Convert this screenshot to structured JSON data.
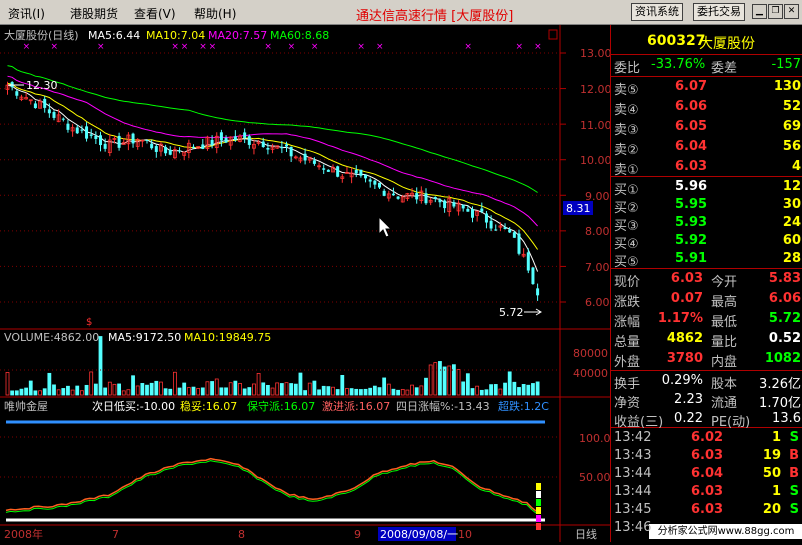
{
  "menu": {
    "items": [
      "资讯(I)",
      "港股期货",
      "查看(V)",
      "帮助(H)"
    ],
    "title": "通达信高速行情 [大厦股份]",
    "buttons": [
      "资讯系统",
      "委托交易"
    ]
  },
  "kline": {
    "header": {
      "name": "大厦股份(日线)",
      "ma5": "MA5:6.44",
      "ma10": "MA10:7.04",
      "ma20": "MA20:7.57",
      "ma60": "MA60:8.68"
    },
    "y_ticks": [
      "13.00",
      "12.00",
      "11.00",
      "10.00",
      "9.00",
      "8.00",
      "7.00",
      "6.00"
    ],
    "cursor_price": "8.31",
    "high_label": "12.30",
    "low_label": "5.72",
    "colors": {
      "ma5": "#ffffff",
      "ma10": "#ffff00",
      "ma20": "#ff00ff",
      "ma60": "#00ff00",
      "up": "#ff3232",
      "down": "#54ffff"
    }
  },
  "volume": {
    "header": {
      "vol": "VOLUME:4862.00",
      "ma5": "MA5:9172.50",
      "ma10": "MA10:19849.75"
    },
    "y_ticks": [
      "80000",
      "40000"
    ]
  },
  "indicator": {
    "header": {
      "name": "唯帅金屋",
      "a": "次日低买:-10.00",
      "b": "稳妥:16.07",
      "c": "保守派:16.07",
      "d": "激进派:16.07",
      "e": "四日涨幅%:-13.43",
      "f": "超跌:1.2C"
    },
    "y_ticks": [
      "100.0",
      "50.00"
    ]
  },
  "xaxis": {
    "labels": [
      "2008年",
      "7",
      "8",
      "9",
      "10"
    ],
    "cursor_date": "2008/09/08/一",
    "period": "日线"
  },
  "panel": {
    "code": "600327",
    "name": "大厦股份",
    "webi_label": "委比",
    "webi_value": "-33.76%",
    "wecha_label": "委差",
    "wecha_value": "-157",
    "sell": [
      {
        "label": "卖⑤",
        "price": "6.07",
        "vol": "130"
      },
      {
        "label": "卖④",
        "price": "6.06",
        "vol": "52"
      },
      {
        "label": "卖③",
        "price": "6.05",
        "vol": "69"
      },
      {
        "label": "卖②",
        "price": "6.04",
        "vol": "56"
      },
      {
        "label": "卖①",
        "price": "6.03",
        "vol": "4"
      }
    ],
    "buy": [
      {
        "label": "买①",
        "price": "5.96",
        "vol": "12"
      },
      {
        "label": "买②",
        "price": "5.95",
        "vol": "30"
      },
      {
        "label": "买③",
        "price": "5.93",
        "vol": "24"
      },
      {
        "label": "买④",
        "price": "5.92",
        "vol": "60"
      },
      {
        "label": "买⑤",
        "price": "5.91",
        "vol": "28"
      }
    ],
    "quote": [
      {
        "l1": "现价",
        "v1": "6.03",
        "l2": "今开",
        "v2": "5.83"
      },
      {
        "l1": "涨跌",
        "v1": "0.07",
        "l2": "最高",
        "v2": "6.06"
      },
      {
        "l1": "涨幅",
        "v1": "1.17%",
        "l2": "最低",
        "v2": "5.72"
      },
      {
        "l1": "总量",
        "v1": "4862",
        "l2": "量比",
        "v2": "0.52"
      },
      {
        "l1": "外盘",
        "v1": "3780",
        "l2": "内盘",
        "v2": "1082"
      }
    ],
    "fin": [
      {
        "l1": "换手",
        "v1": "0.29%",
        "l2": "股本",
        "v2": "3.26亿"
      },
      {
        "l1": "净资",
        "v1": "2.23",
        "l2": "流通",
        "v2": "1.70亿"
      },
      {
        "l1": "收益(三)",
        "v1": "0.22",
        "l2": "PE(动)",
        "v2": "13.6"
      }
    ],
    "ticks": [
      {
        "time": "13:42",
        "price": "6.02",
        "vol": "1",
        "side": "S"
      },
      {
        "time": "13:43",
        "price": "6.03",
        "vol": "19",
        "side": "B"
      },
      {
        "time": "13:44",
        "price": "6.04",
        "vol": "50",
        "side": "B"
      },
      {
        "time": "13:44",
        "price": "6.03",
        "vol": "1",
        "side": "S"
      },
      {
        "time": "13:45",
        "price": "6.03",
        "vol": "20",
        "side": "S"
      },
      {
        "time": "13:46",
        "price": "",
        "vol": "",
        "side": ""
      }
    ],
    "watermark": "分析家公式网www.88gg.com"
  }
}
